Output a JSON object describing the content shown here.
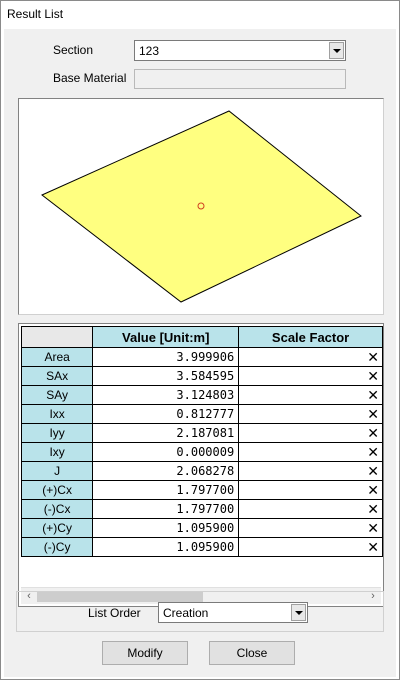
{
  "window": {
    "title": "Result List"
  },
  "form": {
    "section_label": "Section",
    "section_value": "123",
    "base_material_label": "Base Material",
    "base_material_value": ""
  },
  "table": {
    "headers": [
      "",
      "Value [Unit:m]",
      "Scale Factor"
    ],
    "rows": [
      {
        "name": "Area",
        "value": "3.999906",
        "scale": "✕"
      },
      {
        "name": "SAx",
        "value": "3.584595",
        "scale": "✕"
      },
      {
        "name": "SAy",
        "value": "3.124803",
        "scale": "✕"
      },
      {
        "name": "Ixx",
        "value": "0.812777",
        "scale": "✕"
      },
      {
        "name": "Iyy",
        "value": "2.187081",
        "scale": "✕"
      },
      {
        "name": "Ixy",
        "value": "0.000009",
        "scale": "✕"
      },
      {
        "name": "J",
        "value": "2.068278",
        "scale": "✕"
      },
      {
        "name": "(+)Cx",
        "value": "1.797700",
        "scale": "✕"
      },
      {
        "name": "(-)Cx",
        "value": "1.797700",
        "scale": "✕"
      },
      {
        "name": "(+)Cy",
        "value": "1.095900",
        "scale": "✕"
      },
      {
        "name": "(-)Cy",
        "value": "1.095900",
        "scale": "✕"
      }
    ]
  },
  "list_order": {
    "label": "List Order",
    "value": "Creation"
  },
  "buttons": {
    "modify": "Modify",
    "close": "Close"
  },
  "colors": {
    "header_bg": "#b9e3ea",
    "shape_fill": "#ffff80",
    "centroid": "#d04020"
  }
}
